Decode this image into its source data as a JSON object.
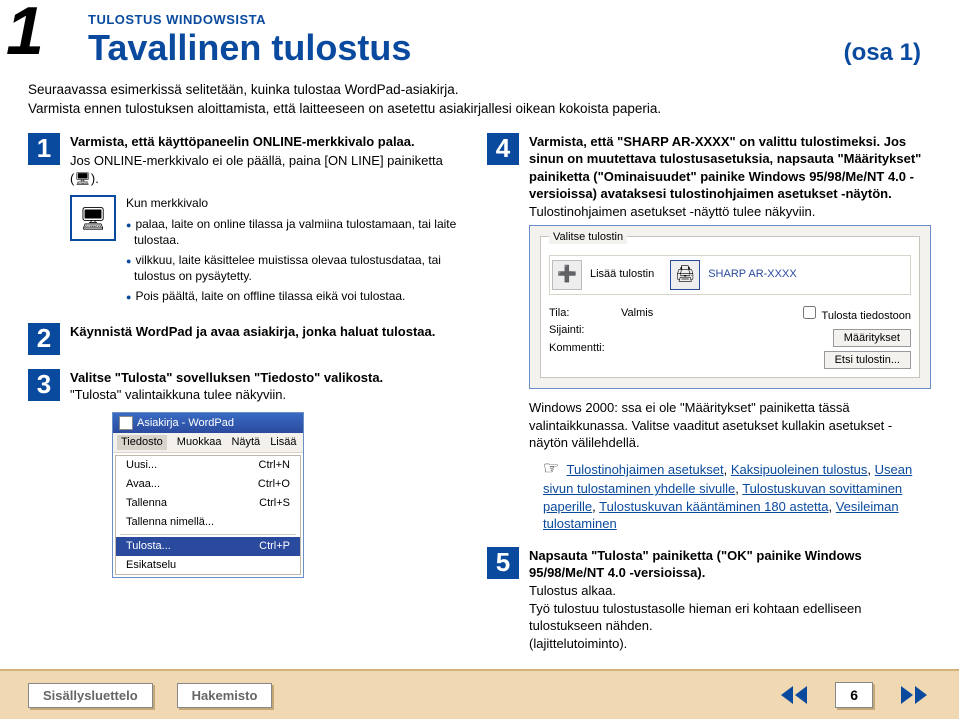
{
  "header": {
    "chapter_num": "1",
    "breadcrumb": "TULOSTUS WINDOWSISTA",
    "title": "Tavallinen tulostus",
    "part": "(osa 1)"
  },
  "intro": "Seuraavassa esimerkissä selitetään, kuinka tulostaa WordPad-asiakirja.\nVarmista ennen tulostuksen aloittamista, että laitteeseen on asetettu asiakirjallesi oikean kokoista paperia.",
  "steps": {
    "s1": {
      "num": "1",
      "p1": "Varmista, että käyttöpaneelin ONLINE-merkkivalo palaa.",
      "p2a": "Jos ONLINE-merkkivalo ei ole päällä, paina [ON LINE] painiketta (",
      "p2b": ").",
      "sub_h": "Kun merkkivalo",
      "b1": "palaa, laite on online tilassa ja valmiina tulostamaan, tai laite tulostaa.",
      "b2": "vilkkuu, laite käsittelee muistissa olevaa tulostusdataa, tai tulostus on pysäytetty.",
      "b3": "Pois päältä, laite on offline tilassa eikä voi tulostaa."
    },
    "s2": {
      "num": "2",
      "p": "Käynnistä WordPad ja avaa asiakirja, jonka haluat tulostaa."
    },
    "s3": {
      "num": "3",
      "p1": "Valitse \"Tulosta\" sovelluksen \"Tiedosto\" valikosta.",
      "p2": "\"Tulosta\" valintaikkuna tulee näkyviin."
    },
    "s4": {
      "num": "4",
      "p1": "Varmista, että \"SHARP AR-XXXX\" on valittu tulostimeksi. Jos sinun on muutettava tulostusasetuksia, napsauta \"Määritykset\" painiketta (\"Ominaisuudet\" painike Windows 95/98/Me/NT 4.0 -versioissa) avataksesi tulostinohjaimen asetukset -näytön.",
      "p2": "Tulostinohjaimen asetukset -näyttö tulee näkyviin.",
      "note1": "Windows 2000: ssa ei ole \"Määritykset\" painiketta tässä valintaikkunassa. Valitse vaaditut asetukset kullakin asetukset -näytön välilehdellä.",
      "links": {
        "l1": "Tulostinohjaimen asetukset",
        "l2": "Kaksipuoleinen tulostus",
        "l3": "Usean sivun tulostaminen yhdelle sivulle",
        "l4": "Tulostuskuvan sovittaminen paperille",
        "l5": "Tulostuskuvan kääntäminen 180 astetta",
        "l6": "Vesileiman tulostaminen"
      }
    },
    "s5": {
      "num": "5",
      "p1": "Napsauta \"Tulosta\" painiketta (\"OK\" painike Windows 95/98/Me/NT 4.0 -versioissa).",
      "p2": "Tulostus alkaa.",
      "p3": "Työ tulostuu tulostustasolle hieman eri kohtaan edelliseen tulostukseen nähden.",
      "p4": "(lajittelutoiminto)."
    }
  },
  "wordpad": {
    "title": "Asiakirja - WordPad",
    "menus": {
      "m1": "Tiedosto",
      "m2": "Muokkaa",
      "m3": "Näytä",
      "m4": "Lisää"
    },
    "items": {
      "i1": "Uusi...",
      "k1": "Ctrl+N",
      "i2": "Avaa...",
      "k2": "Ctrl+O",
      "i3": "Tallenna",
      "k3": "Ctrl+S",
      "i4": "Tallenna nimellä...",
      "i5": "Tulosta...",
      "k5": "Ctrl+P",
      "i6": "Esikatselu"
    }
  },
  "dialog": {
    "title": "Valitse tulostin",
    "add": "Lisää tulostin",
    "printer": "SHARP AR-XXXX",
    "lbl_tila": "Tila:",
    "val_tila": "Valmis",
    "lbl_sij": "Sijainti:",
    "lbl_kom": "Kommentti:",
    "chk": "Tulosta tiedostoon",
    "btn1": "Määritykset",
    "btn2": "Etsi tulostin..."
  },
  "footer": {
    "toc": "Sisällysluettelo",
    "index": "Hakemisto",
    "page": "6"
  },
  "icons": {
    "pc": "🖥",
    "pointer": "☞",
    "monitor_small": "🖥",
    "cursor": "↖"
  }
}
